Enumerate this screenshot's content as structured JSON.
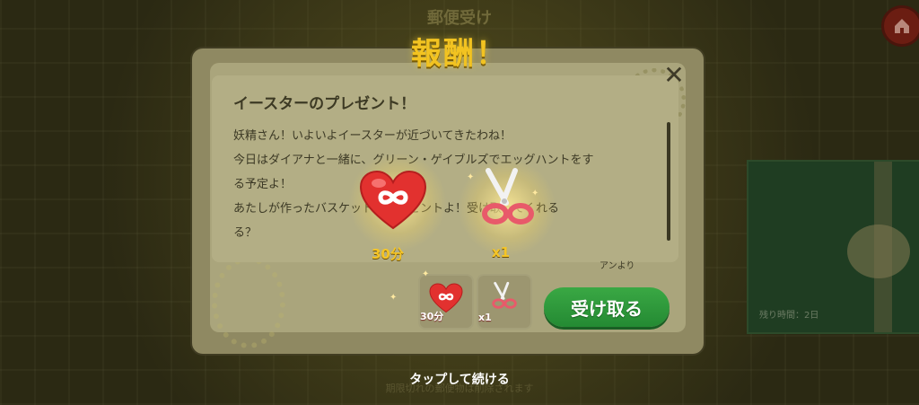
{
  "background": {
    "header_title": "郵便受け",
    "deadline_text": "残り時間：2日",
    "footer_text": "期限切れの郵便物は削除されます"
  },
  "reward": {
    "title": "報酬！",
    "items": [
      {
        "icon": "heart-infinity-icon",
        "label": "30分"
      },
      {
        "icon": "scissors-icon",
        "label": "x1"
      }
    ],
    "slots": [
      {
        "icon": "heart-infinity-icon",
        "label": "30分"
      },
      {
        "icon": "scissors-icon",
        "label": "x1"
      }
    ],
    "receive_button": "受け取る",
    "tap_continue": "タップして続ける"
  },
  "message": {
    "title": "イースターのプレゼント！",
    "lines": [
      "妖精さん！いよいよイースターが近づいてきたわね！",
      "今日はダイアナと一緒に、グリーン・ゲイブルズでエッグハントをす",
      "る予定よ！",
      "あたしが作ったバスケットのプレゼントよ！受け取ってくれる",
      "る？"
    ],
    "signature": "アンより"
  },
  "colors": {
    "gold": "#f2c321",
    "green_button": "#2e9a3c",
    "heart_red": "#e2312f"
  }
}
